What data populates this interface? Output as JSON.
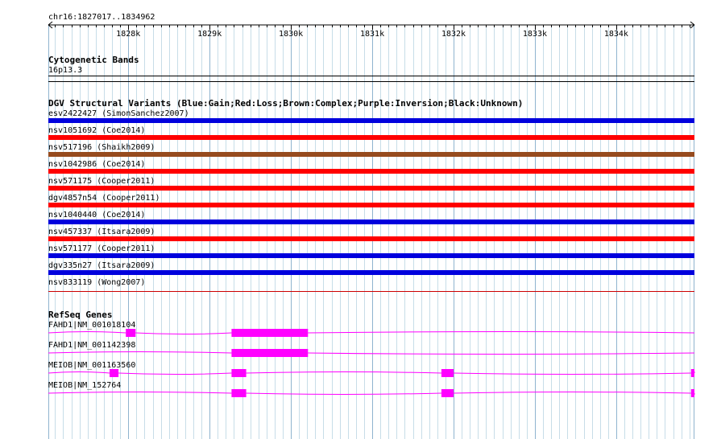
{
  "region": "chr16:1827017..1834962",
  "ruler": {
    "start": 1827017,
    "end": 1834962,
    "labels": [
      {
        "pos": 1828000,
        "label": "1828k"
      },
      {
        "pos": 1829000,
        "label": "1829k"
      },
      {
        "pos": 1830000,
        "label": "1830k"
      },
      {
        "pos": 1831000,
        "label": "1831k"
      },
      {
        "pos": 1832000,
        "label": "1832k"
      },
      {
        "pos": 1833000,
        "label": "1833k"
      },
      {
        "pos": 1834000,
        "label": "1834k"
      }
    ]
  },
  "cytobands": {
    "title": "Cytogenetic Bands",
    "band": "16p13.3"
  },
  "dgv": {
    "title": "DGV Structural Variants (Blue:Gain;Red:Loss;Brown:Complex;Purple:Inversion;Black:Unknown)",
    "colors": {
      "gain": "#0000dd",
      "loss": "#ff0000",
      "complex": "#964b1e",
      "thin_loss": "#cc0000"
    },
    "variants": [
      {
        "label": "esv2422427 (SimonSanchez2007)",
        "type": "gain"
      },
      {
        "label": "nsv1051692 (Coe2014)",
        "type": "loss"
      },
      {
        "label": "nsv517196 (Shaikh2009)",
        "type": "complex"
      },
      {
        "label": "nsv1042986 (Coe2014)",
        "type": "loss"
      },
      {
        "label": "nsv571175 (Cooper2011)",
        "type": "loss"
      },
      {
        "label": "dgv4857n54 (Cooper2011)",
        "type": "loss"
      },
      {
        "label": "nsv1040440 (Coe2014)",
        "type": "gain"
      },
      {
        "label": "nsv457337 (Itsara2009)",
        "type": "loss"
      },
      {
        "label": "nsv571177 (Cooper2011)",
        "type": "gain"
      },
      {
        "label": "dgv335n27 (Itsara2009)",
        "type": "gain"
      },
      {
        "label": "nsv833119 (Wong2007)",
        "type": "thin_loss"
      }
    ]
  },
  "refseq": {
    "title": "RefSeq Genes",
    "color": "#ff00ff",
    "genes": [
      {
        "label": "FAHD1|NM_001018104",
        "exons": [
          [
            1827970,
            1828090
          ],
          [
            1829270,
            1830210
          ]
        ]
      },
      {
        "label": "FAHD1|NM_001142398",
        "exons": [
          [
            1829270,
            1830210
          ]
        ]
      },
      {
        "label": "MEIOB|NM_001163560",
        "exons": [
          [
            1827770,
            1827880
          ],
          [
            1829270,
            1829450
          ],
          [
            1831850,
            1832000
          ],
          [
            1834920,
            1834962
          ]
        ]
      },
      {
        "label": "MEIOB|NM_152764",
        "exons": [
          [
            1829270,
            1829450
          ],
          [
            1831850,
            1832000
          ],
          [
            1834920,
            1834962
          ]
        ]
      }
    ]
  }
}
